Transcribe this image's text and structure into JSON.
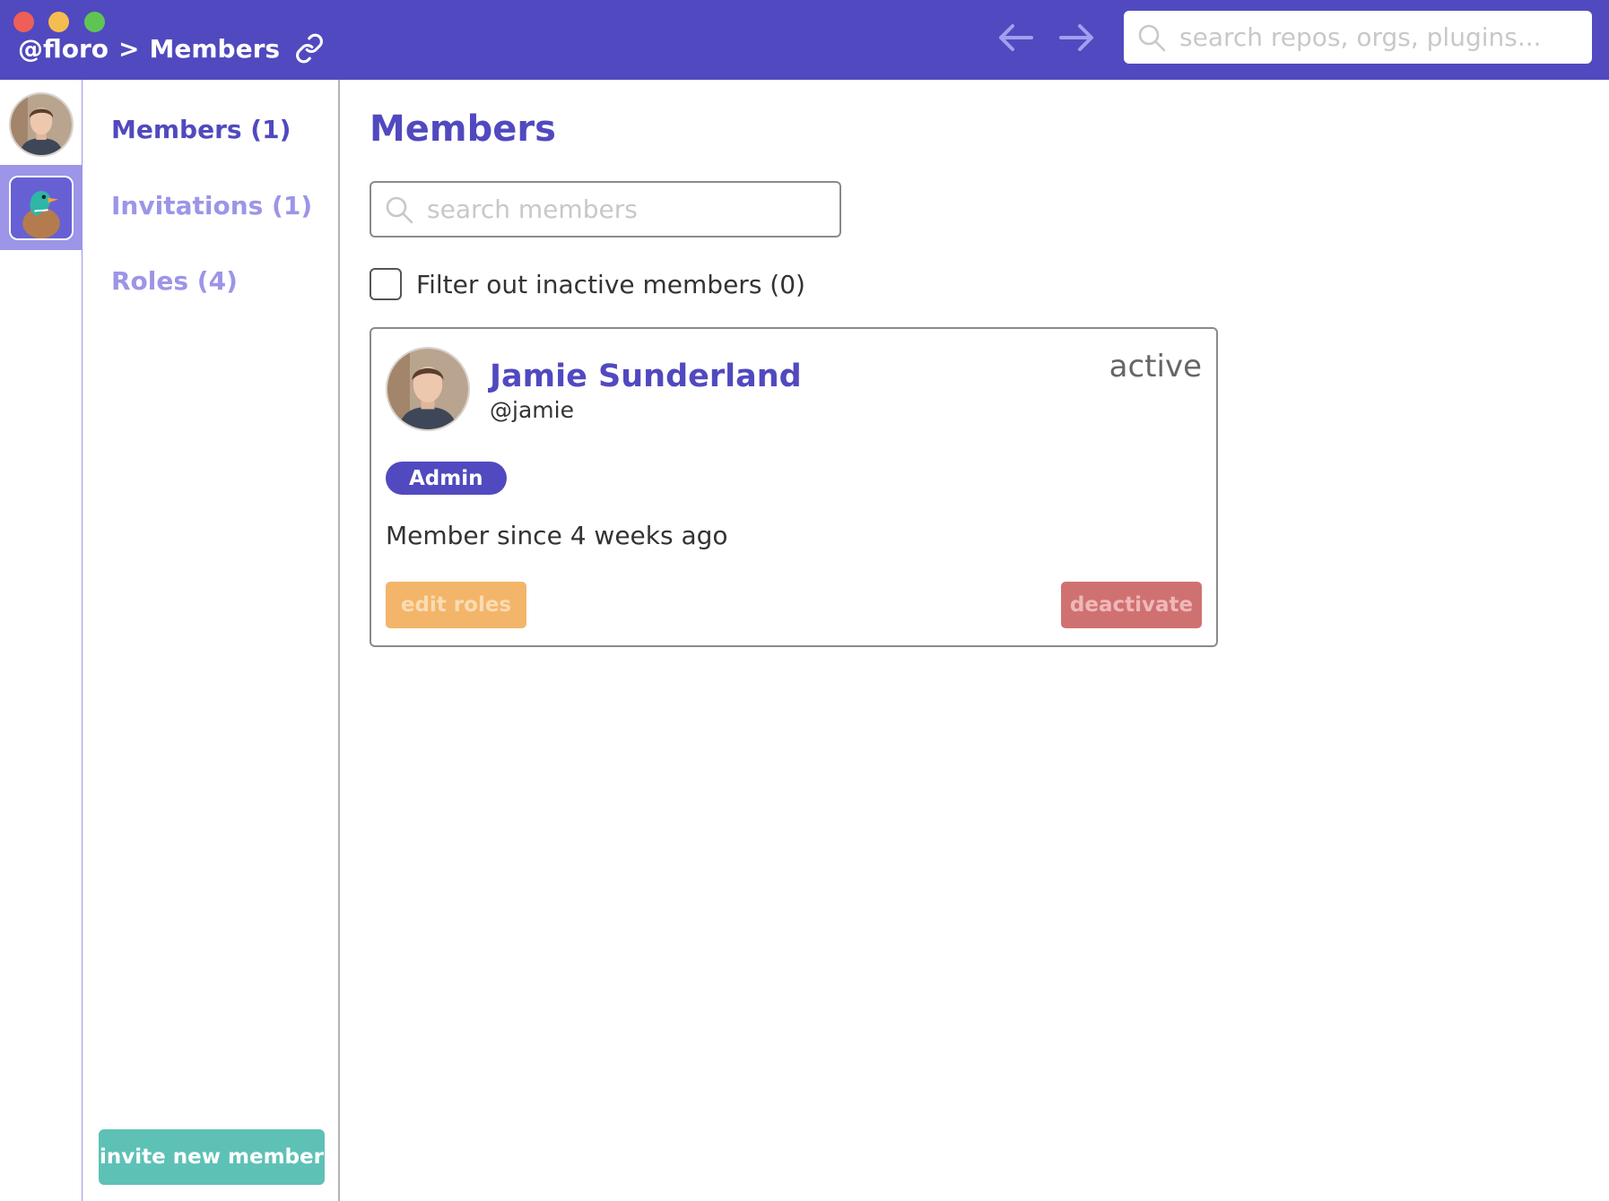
{
  "titlebar": {
    "breadcrumb_org": "@floro",
    "breadcrumb_sep": ">",
    "breadcrumb_page": "Members",
    "search_placeholder": "search repos, orgs, plugins...",
    "bg_color": "#5149bf"
  },
  "icons": {
    "link": "link-icon",
    "back": "arrow-left-icon",
    "forward": "arrow-right-icon",
    "search": "search-icon"
  },
  "sidebar": {
    "items": [
      {
        "label": "Members (1)",
        "active": true
      },
      {
        "label": "Invitations (1)",
        "active": false
      },
      {
        "label": "Roles (4)",
        "active": false
      }
    ],
    "invite_button": "invite new member"
  },
  "main": {
    "title": "Members",
    "search_placeholder": "search members",
    "filter_label": "Filter out inactive members (0)",
    "filter_checked": false,
    "members": [
      {
        "name": "Jamie Sunderland",
        "handle": "@jamie",
        "status": "active",
        "role": "Admin",
        "member_since": "Member since 4 weeks ago",
        "edit_label": "edit roles",
        "deactivate_label": "deactivate"
      }
    ]
  },
  "colors": {
    "primary": "#5149bf",
    "primary_light": "#9c95e8",
    "teal": "#5ec1b6",
    "orange": "#f3b56a",
    "red": "#d07171"
  }
}
